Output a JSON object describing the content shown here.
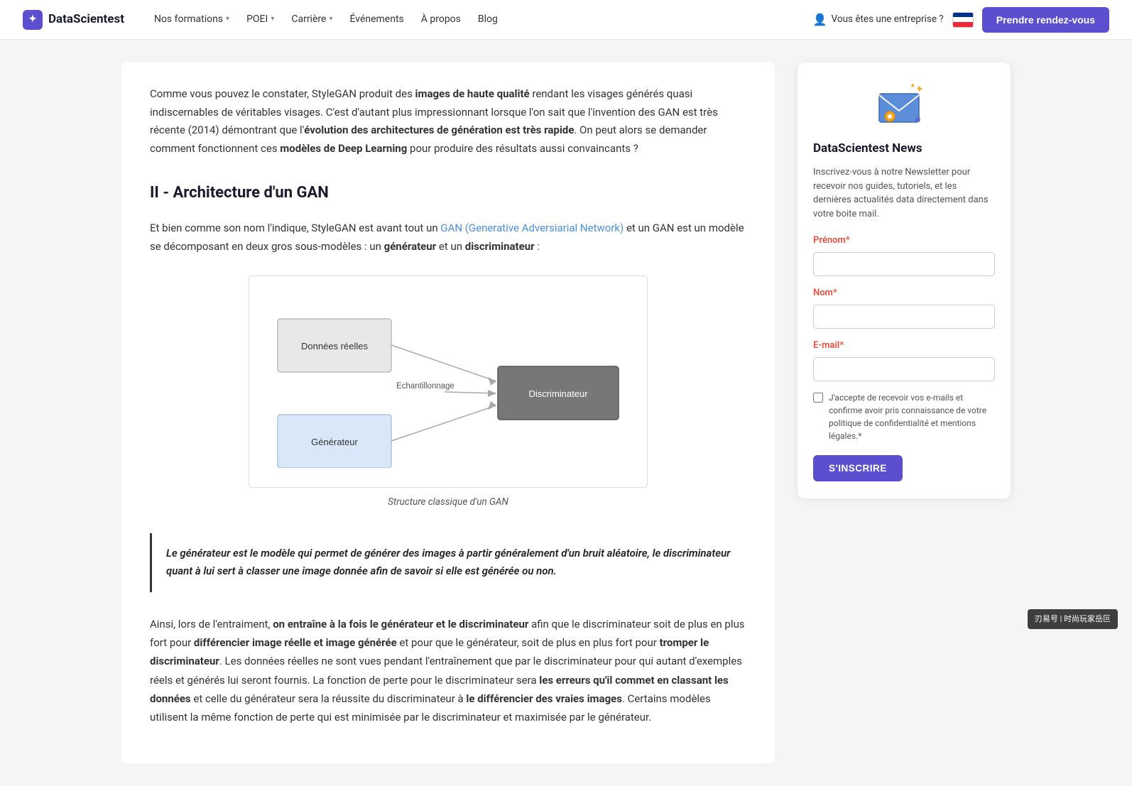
{
  "nav": {
    "logo_text": "DataScientest",
    "links": [
      {
        "label": "Nos formations",
        "has_dropdown": true
      },
      {
        "label": "POEI",
        "has_dropdown": true
      },
      {
        "label": "Carrière",
        "has_dropdown": true
      },
      {
        "label": "Événements",
        "has_dropdown": false
      },
      {
        "label": "À propos",
        "has_dropdown": false
      },
      {
        "label": "Blog",
        "has_dropdown": false
      }
    ],
    "enterprise_label": "Vous êtes une entreprise ?",
    "cta_label": "Prendre rendez-vous"
  },
  "article": {
    "intro_paragraph_html": "Comme vous pouvez le constater, StyleGAN produit des <strong>images de haute qualité</strong> rendant les visages générés quasi indiscernables de véritables visages. C'est d'autant plus impressionnant lorsque l'on sait que l'invention des GAN est très récente (2014) démontrant que l'<strong>évolution des architectures de génération est très rapide</strong>. On peut alors se demander comment fonctionnent ces <strong>modèles de Deep Learning</strong> pour produire des résultats aussi convaincants ?",
    "section2_title": "II - Architecture d'un GAN",
    "section2_intro_html": "Et bien comme son nom l'indique, StyleGAN est avant tout un <a href=\"#\">GAN (Generative Adversiarial Network)</a> et un GAN est un modèle se décomposant en deux gros sous-modèles : un <strong>générateur</strong> et un <strong>discriminateur</strong> :",
    "diagram": {
      "caption": "Structure classique d'un GAN",
      "box1_label": "Données réelles",
      "box2_label": "Discriminateur",
      "box3_label": "Générateur",
      "arrow_label": "Echantillonnage"
    },
    "quote_html": "<strong>Le générateur est le modèle qui permet de générer des images à partir généralement d'un bruit aléatoire, le discriminateur quant à lui sert à classer une image donnée afin de savoir si elle est générée ou non.</strong>",
    "body1_html": "Ainsi, lors de l'entraiment, <strong>on entraîne à la fois le générateur et le discriminateur</strong> afin que le discriminateur soit de plus en plus fort pour <strong>différencier image réelle et image générée</strong> et pour que le générateur, soit de plus en plus fort pour <strong>tromper le discriminateur</strong>. Les données réelles ne sont vues pendant l'entraînement que par le discriminateur pour qui autant d'exemples réels et générés lui seront fournis. La fonction de perte pour le discriminateur sera <strong>les erreurs qu'il commet en classant les données</strong> et celle du générateur sera la réussite du discriminateur à <strong>le différencier des vraies images</strong>. Certains modèles utilisent la même fonction de perte qui est minimisée par le discriminateur et maximisée par le générateur."
  },
  "newsletter": {
    "title": "DataScientest News",
    "description": "Inscrivez-vous à notre Newsletter pour recevoir nos guides, tutoriels, et les dernières actualités data directement dans votre boite mail.",
    "prenom_label": "Prénom",
    "prenom_required": "*",
    "nom_label": "Nom",
    "nom_required": "*",
    "email_label": "E-mail",
    "email_required": "*",
    "checkbox_label": "J'accepte de recevoir vos e-mails et confirme avoir pris connaissance de votre politique de confidentialité et mentions légales.",
    "checkbox_required": "*",
    "submit_label": "S'INSCRIRE"
  },
  "bottom_badge": {
    "text": "刃易号 | 时尚玩家岳叵"
  }
}
